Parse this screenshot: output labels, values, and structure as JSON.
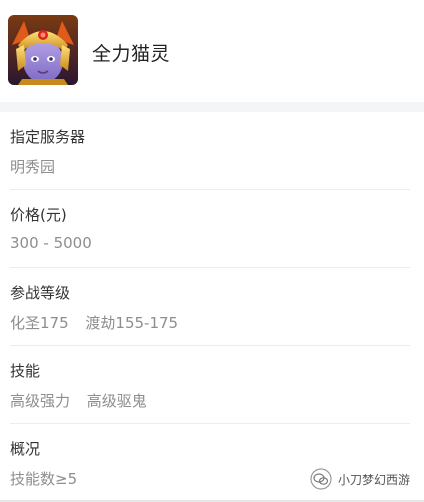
{
  "header": {
    "title": "全力猫灵"
  },
  "sections": [
    {
      "label": "指定服务器",
      "values": [
        "明秀园"
      ]
    },
    {
      "label": "价格(元)",
      "values": [
        "300 - 5000"
      ]
    },
    {
      "label": "参战等级",
      "values": [
        "化圣175",
        "渡劫155-175"
      ]
    },
    {
      "label": "技能",
      "values": [
        "高级强力",
        "高级驱鬼"
      ]
    },
    {
      "label": "概况",
      "values": [
        "技能数≥5"
      ]
    }
  ],
  "watermark": {
    "text": "小刀梦幻西游",
    "icon": "wechat-official-account-icon"
  },
  "colors": {
    "title": "#222222",
    "label": "#333333",
    "value": "#8e8e8e",
    "band": "#f4f5f6",
    "divider": "#ececec"
  }
}
